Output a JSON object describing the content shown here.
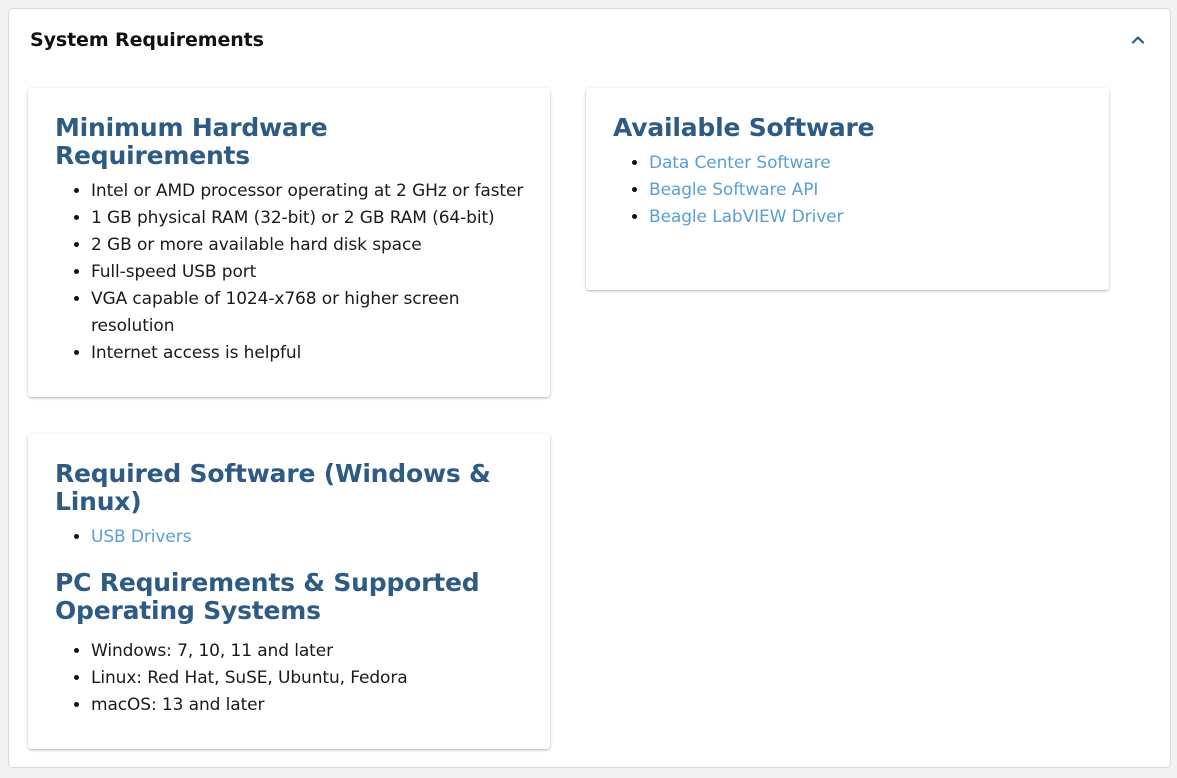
{
  "panel": {
    "title": "System Requirements"
  },
  "colors": {
    "heading": "#2e5b84",
    "link": "#5a9fd4",
    "text": "#1a1a1a"
  },
  "hardware": {
    "heading": "Minimum Hardware Requirements",
    "items": [
      "Intel or AMD processor operating at 2 GHz or faster",
      "1 GB physical RAM (32-bit) or 2 GB RAM (64-bit)",
      "2 GB or more available hard disk space",
      "Full-speed USB port",
      "VGA capable of 1024-x768 or higher screen resolution",
      "Internet access is helpful"
    ]
  },
  "available_software": {
    "heading": "Available Software",
    "links": [
      "Data Center Software",
      "Beagle Software API",
      "Beagle LabVIEW Driver"
    ]
  },
  "required_software": {
    "heading": "Required Software (Windows & Linux)",
    "links": [
      "USB Drivers"
    ]
  },
  "pc_requirements": {
    "heading": "PC Requirements & Supported Operating Systems",
    "items": [
      "Windows: 7, 10, 11 and later",
      "Linux: Red Hat, SuSE, Ubuntu, Fedora",
      "macOS: 13 and later"
    ]
  }
}
